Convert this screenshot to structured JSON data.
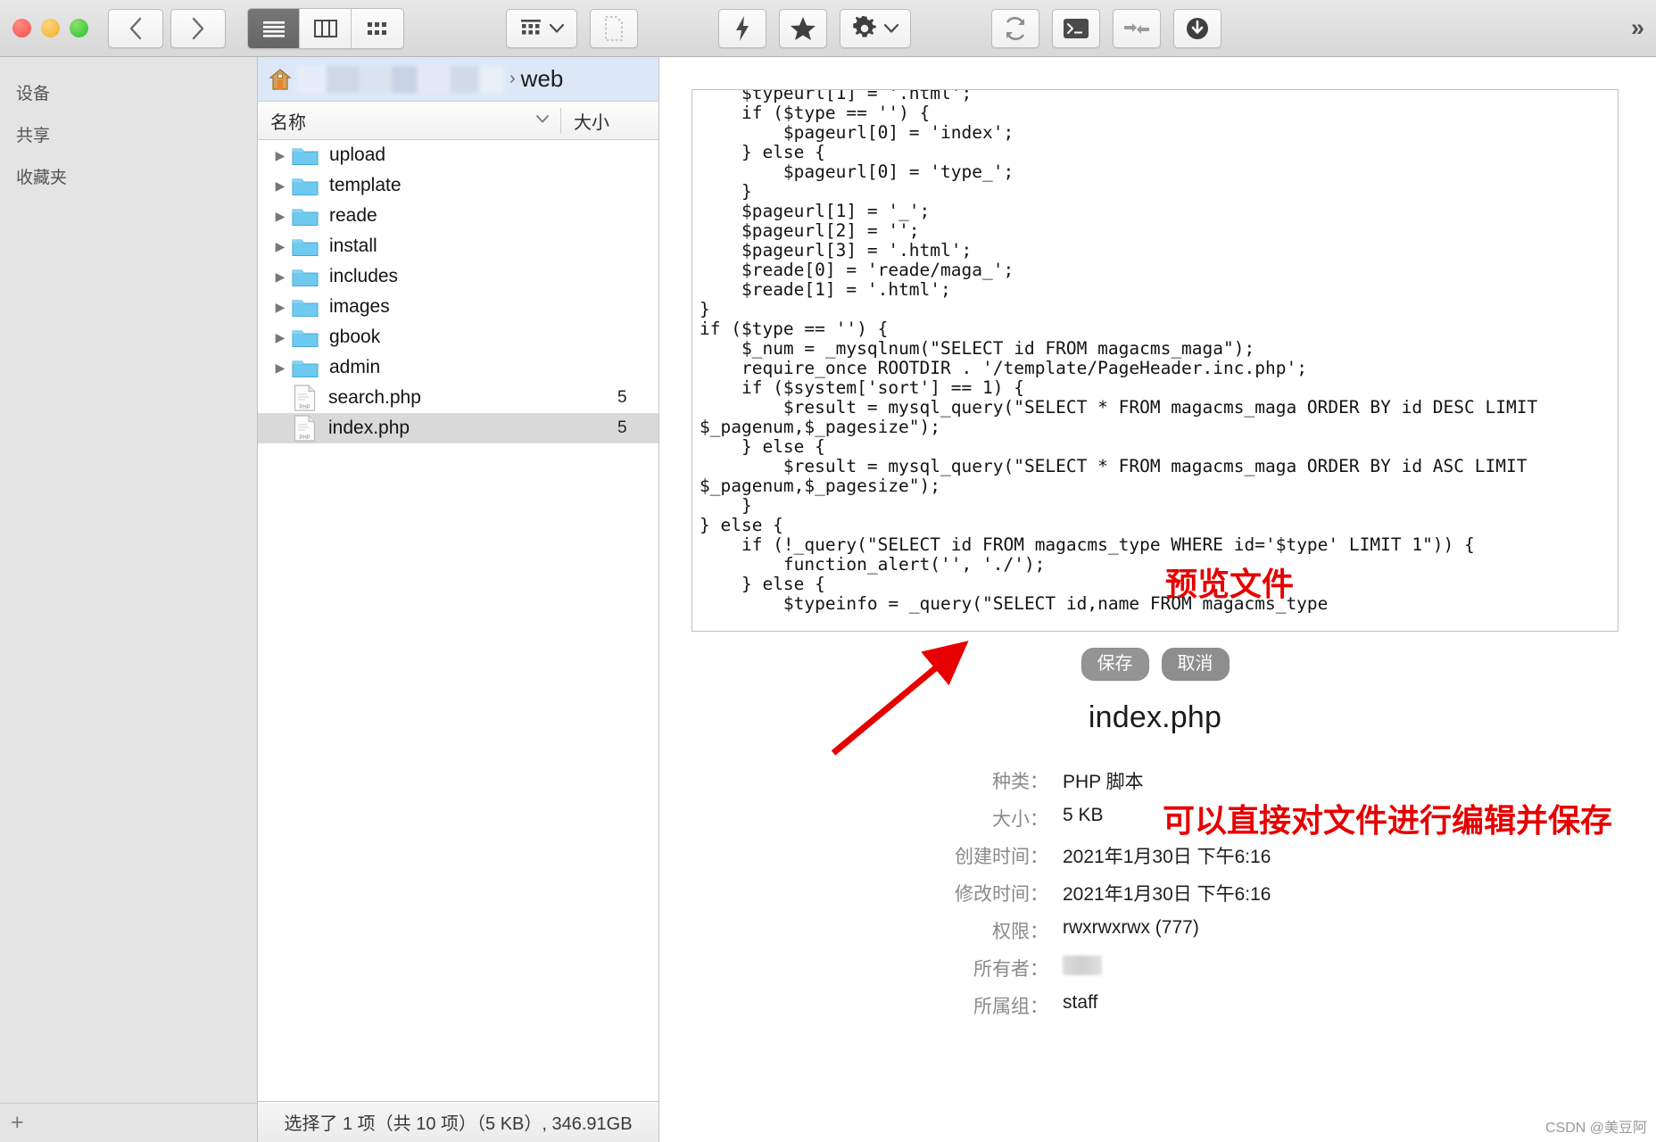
{
  "window": {
    "traffic_lights": [
      "close",
      "minimize",
      "zoom"
    ]
  },
  "toolbar": {
    "back_icon": "chevron-left-icon",
    "forward_icon": "chevron-right-icon",
    "view_list_icon": "list-view-icon",
    "view_column_icon": "column-view-icon",
    "view_grid_icon": "grid-view-icon",
    "arrange_icon": "arrange-grid-icon",
    "arrange_caret": "chevron-down-icon",
    "newfile_icon": "new-file-icon",
    "quick_icon": "lightning-bolt-icon",
    "favorite_icon": "star-icon",
    "settings_icon": "gear-icon",
    "settings_caret": "chevron-down-icon",
    "refresh_icon": "refresh-icon",
    "terminal_icon": "terminal-icon",
    "transfer_icon": "transfer-sync-icon",
    "download_icon": "download-circle-icon",
    "overflow_label": "»"
  },
  "sidebar": {
    "items": [
      {
        "label": "设备"
      },
      {
        "label": "共享"
      },
      {
        "label": "收藏夹"
      }
    ],
    "add_label": "+"
  },
  "breadcrumb": {
    "home_icon": "home-icon",
    "separator": "›",
    "current": "web"
  },
  "columns": {
    "name": "名称",
    "size": "大小",
    "sort_caret": "chevron-down-icon"
  },
  "files": [
    {
      "name": "upload",
      "type": "folder",
      "size": ""
    },
    {
      "name": "template",
      "type": "folder",
      "size": ""
    },
    {
      "name": "reade",
      "type": "folder",
      "size": ""
    },
    {
      "name": "install",
      "type": "folder",
      "size": ""
    },
    {
      "name": "includes",
      "type": "folder",
      "size": ""
    },
    {
      "name": "images",
      "type": "folder",
      "size": ""
    },
    {
      "name": "gbook",
      "type": "folder",
      "size": ""
    },
    {
      "name": "admin",
      "type": "folder",
      "size": ""
    },
    {
      "name": "search.php",
      "type": "php",
      "size": "5"
    },
    {
      "name": "index.php",
      "type": "php",
      "size": "5",
      "selected": true
    }
  ],
  "status": "选择了 1 项（共 10 项）（5 KB）, 346.91GB",
  "preview": {
    "code": "    $typeurl[1] = '.html';\n    if ($type == '') {\n        $pageurl[0] = 'index';\n    } else {\n        $pageurl[0] = 'type_';\n    }\n    $pageurl[1] = '_';\n    $pageurl[2] = '';\n    $pageurl[3] = '.html';\n    $reade[0] = 'reade/maga_';\n    $reade[1] = '.html';\n}\nif ($type == '') {\n    $_num = _mysqlnum(\"SELECT id FROM magacms_maga\");\n    require_once ROOTDIR . '/template/PageHeader.inc.php';\n    if ($system['sort'] == 1) {\n        $result = mysql_query(\"SELECT * FROM magacms_maga ORDER BY id DESC LIMIT $_pagenum,$_pagesize\");\n    } else {\n        $result = mysql_query(\"SELECT * FROM magacms_maga ORDER BY id ASC LIMIT $_pagenum,$_pagesize\");\n    }\n} else {\n    if (!_query(\"SELECT id FROM magacms_type WHERE id='$type' LIMIT 1\")) {\n        function_alert('', './');\n    } else {\n        $typeinfo = _query(\"SELECT id,name FROM magacms_type",
    "save_label": "保存",
    "cancel_label": "取消",
    "file_title": "index.php",
    "meta": [
      {
        "key": "种类：",
        "value": "PHP 脚本"
      },
      {
        "key": "大小：",
        "value": "5 KB"
      },
      {
        "key": "创建时间：",
        "value": "2021年1月30日 下午6:16"
      },
      {
        "key": "修改时间：",
        "value": "2021年1月30日 下午6:16"
      },
      {
        "key": "权限：",
        "value": "rwxrwxrwx (777)"
      },
      {
        "key": "所有者：",
        "value": "",
        "blurred": true
      },
      {
        "key": "所属组：",
        "value": "staff"
      }
    ]
  },
  "annotations": {
    "preview_file": "预览文件",
    "edit_save": "可以直接对文件进行编辑并保存",
    "arrow_color": "#e60000"
  },
  "watermark": "CSDN @美豆阿"
}
